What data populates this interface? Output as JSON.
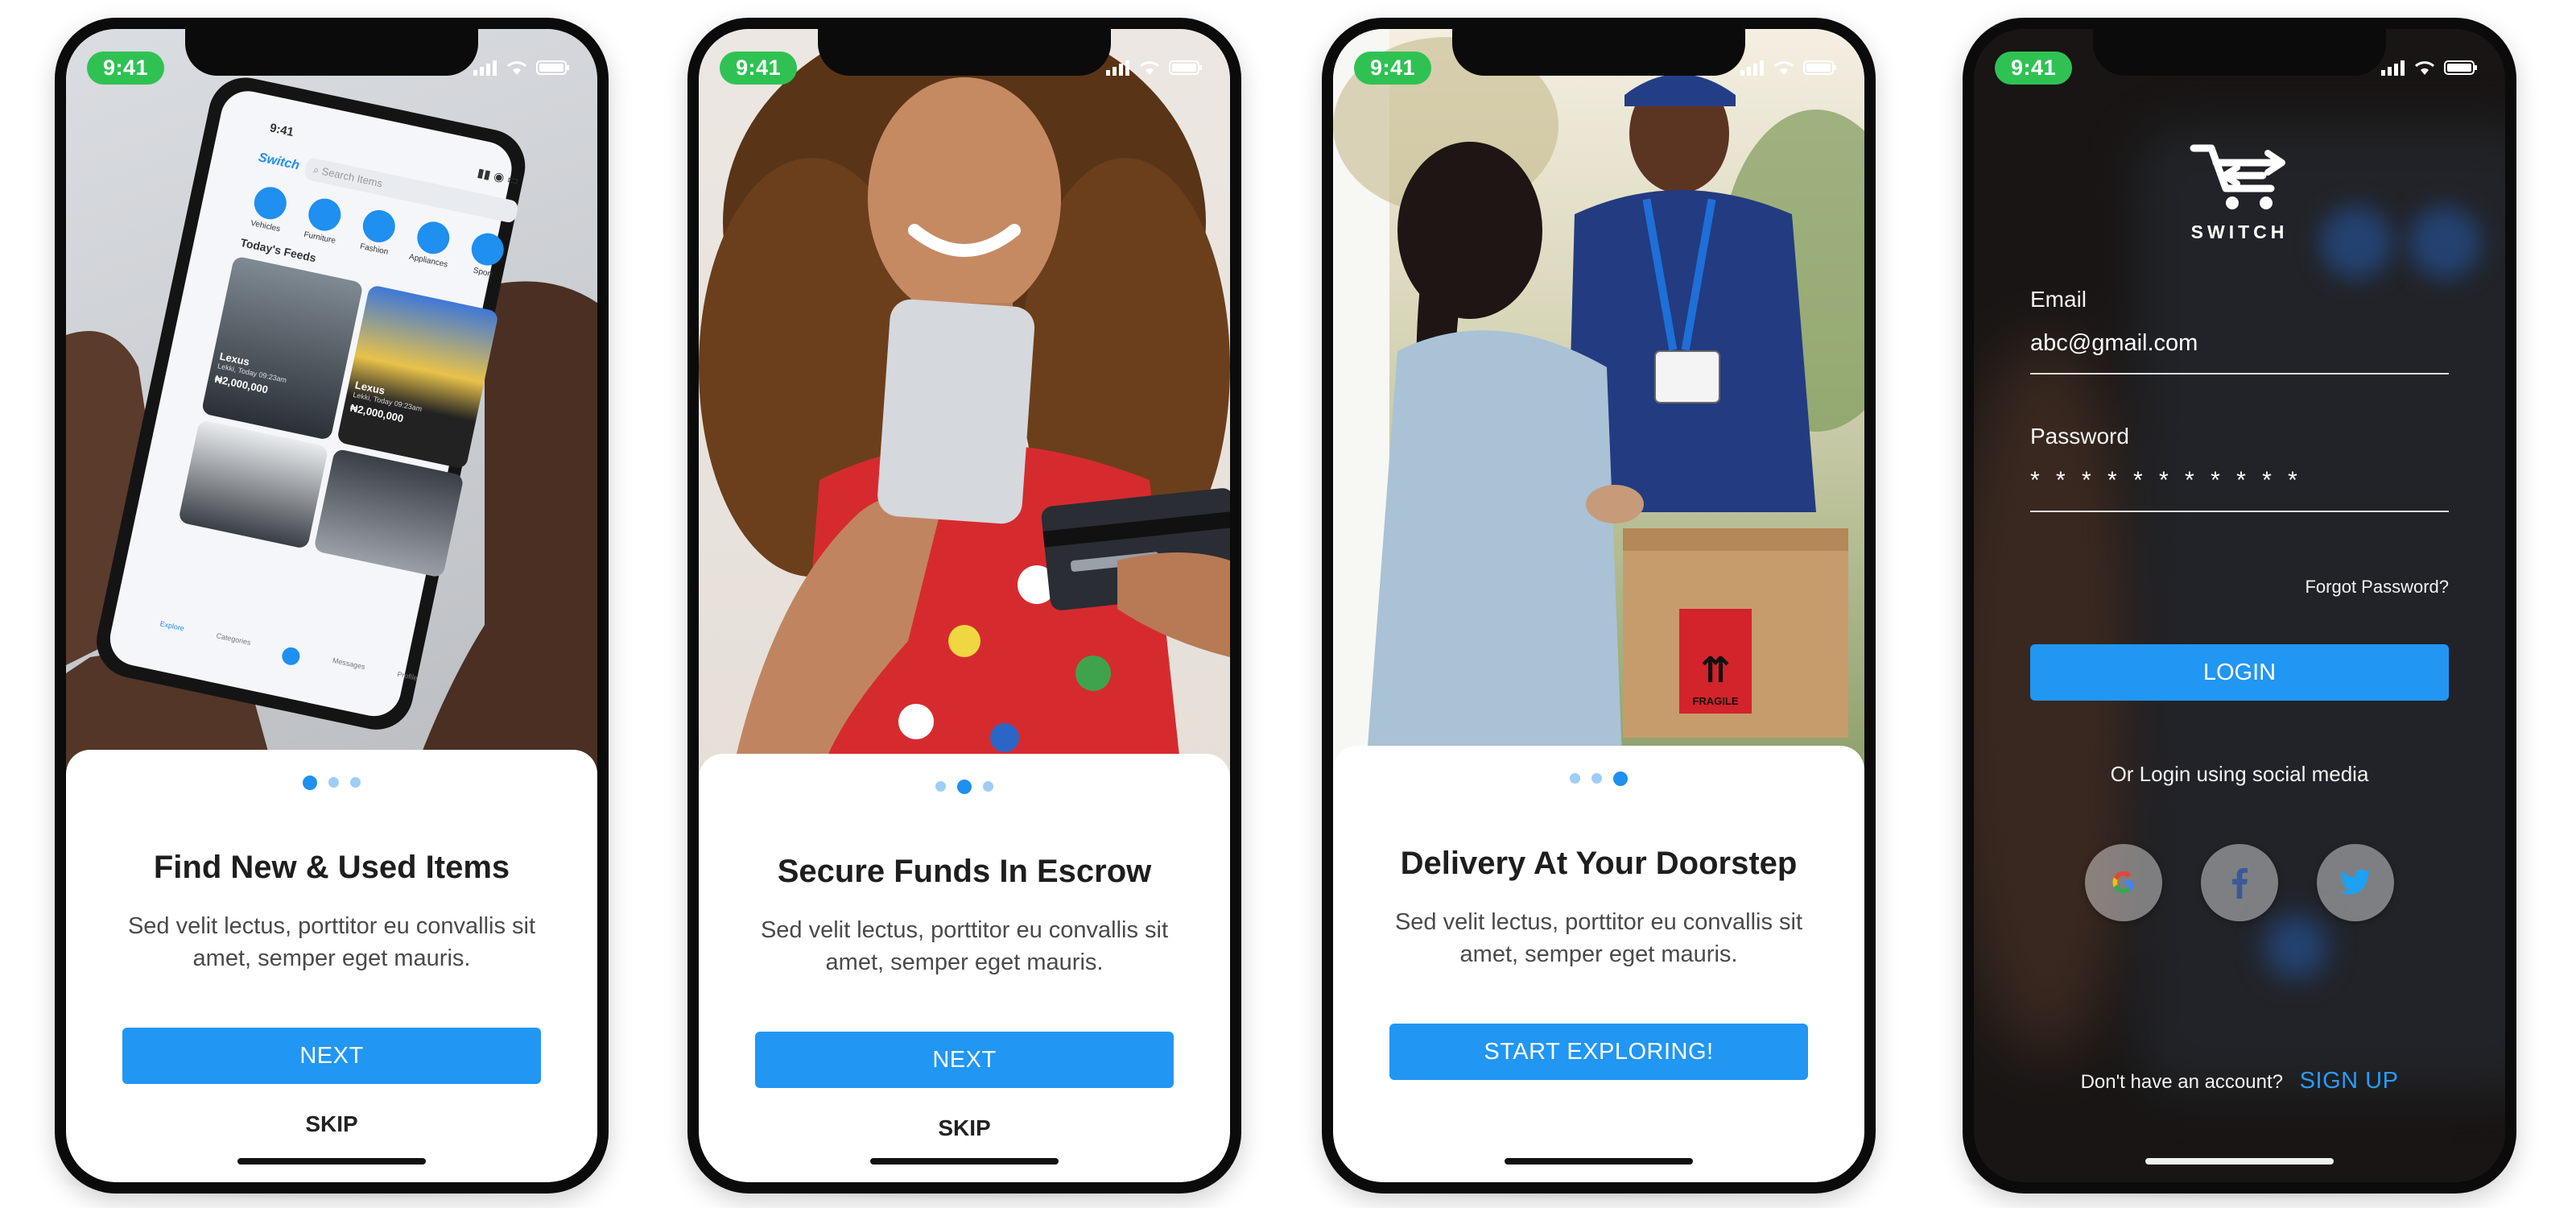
{
  "status_bar": {
    "time": "9:41"
  },
  "screens": [
    {
      "title": "Find New & Used Items",
      "description": "Sed velit lectus, porttitor eu convallis sit amet, semper eget mauris.",
      "primary_label": "NEXT",
      "skip_label": "SKIP",
      "active_page": 0,
      "mock_app": {
        "time": "9:41",
        "logo": "Switch",
        "search_placeholder": "Search Items",
        "categories": [
          "Vehicles",
          "Furniture",
          "Fashion",
          "Appliances",
          "Sport"
        ],
        "feeds_title": "Today's Feeds",
        "tabs": [
          "Explore",
          "Categories",
          "",
          "Messages",
          "Profile"
        ],
        "listings": [
          {
            "title": "Lexus",
            "location": "Lekki, Today 09:23am",
            "price": "₦2,000,000"
          },
          {
            "title": "Lexus",
            "location": "Lekki, Today 09:23am",
            "price": "₦2,000,000"
          }
        ]
      }
    },
    {
      "title": "Secure Funds In Escrow",
      "description": "Sed velit lectus, porttitor eu convallis sit amet, semper eget mauris.",
      "primary_label": "NEXT",
      "skip_label": "SKIP",
      "active_page": 1
    },
    {
      "title": "Delivery At Your Doorstep",
      "description": "Sed velit lectus, porttitor eu convallis sit amet, semper eget mauris.",
      "primary_label": "START EXPLORING!",
      "active_page": 2,
      "box_label": "FRAGILE"
    }
  ],
  "login": {
    "logo_text": "SWITCH",
    "email_label": "Email",
    "email_value": "abc@gmail.com",
    "password_label": "Password",
    "password_value": "* * * * * * * * * * *",
    "forgot_label": "Forgot Password?",
    "login_label": "LOGIN",
    "social_caption": "Or Login using social media",
    "social": [
      "google-icon",
      "facebook-icon",
      "twitter-icon"
    ],
    "no_account_text": "Don't have an account?",
    "signup_label": "SIGN UP"
  },
  "colors": {
    "accent": "#2196f3",
    "dot_active": "#1f8ff0",
    "dot_inactive": "#9ecdf6",
    "time_pill": "#2fc253"
  }
}
